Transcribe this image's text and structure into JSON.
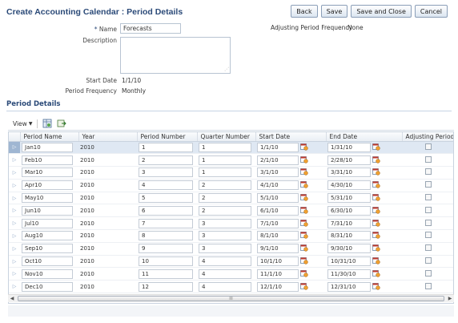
{
  "page": {
    "title": "Create Accounting Calendar : Period Details"
  },
  "toolbar": {
    "back": "Back",
    "save": "Save",
    "save_close": "Save and Close",
    "cancel": "Cancel"
  },
  "form": {
    "name_label": "Name",
    "name_required": "*",
    "name_value": "Forecasts",
    "description_label": "Description",
    "description_value": "",
    "adjusting_label": "Adjusting Period Frequency",
    "adjusting_value": "None",
    "start_date_label": "Start Date",
    "start_date_value": "1/1/10",
    "period_frequency_label": "Period Frequency",
    "period_frequency_value": "Monthly"
  },
  "section": {
    "title": "Period Details"
  },
  "grid_toolbar": {
    "view_label": "View",
    "icons": [
      "freeze-icon",
      "detach-icon"
    ]
  },
  "table": {
    "columns": [
      "Period Name",
      "Year",
      "Period Number",
      "Quarter Number",
      "Start Date",
      "End Date",
      "Adjusting Period"
    ],
    "rows": [
      [
        "Jan10",
        "2010",
        "1",
        "1",
        "1/1/10",
        "1/31/10"
      ],
      [
        "Feb10",
        "2010",
        "2",
        "1",
        "2/1/10",
        "2/28/10"
      ],
      [
        "Mar10",
        "2010",
        "3",
        "1",
        "3/1/10",
        "3/31/10"
      ],
      [
        "Apr10",
        "2010",
        "4",
        "2",
        "4/1/10",
        "4/30/10"
      ],
      [
        "May10",
        "2010",
        "5",
        "2",
        "5/1/10",
        "5/31/10"
      ],
      [
        "Jun10",
        "2010",
        "6",
        "2",
        "6/1/10",
        "6/30/10"
      ],
      [
        "Jul10",
        "2010",
        "7",
        "3",
        "7/1/10",
        "7/31/10"
      ],
      [
        "Aug10",
        "2010",
        "8",
        "3",
        "8/1/10",
        "8/31/10"
      ],
      [
        "Sep10",
        "2010",
        "9",
        "3",
        "9/1/10",
        "9/30/10"
      ],
      [
        "Oct10",
        "2010",
        "10",
        "4",
        "10/1/10",
        "10/31/10"
      ],
      [
        "Nov10",
        "2010",
        "11",
        "4",
        "11/1/10",
        "11/30/10"
      ],
      [
        "Dec10",
        "2010",
        "12",
        "4",
        "12/1/10",
        "12/31/10"
      ]
    ]
  },
  "scrollbar": {
    "thumb_grip": "III"
  },
  "colors": {
    "title": "#2b4a78",
    "selected_row": "#dfe8f3"
  }
}
